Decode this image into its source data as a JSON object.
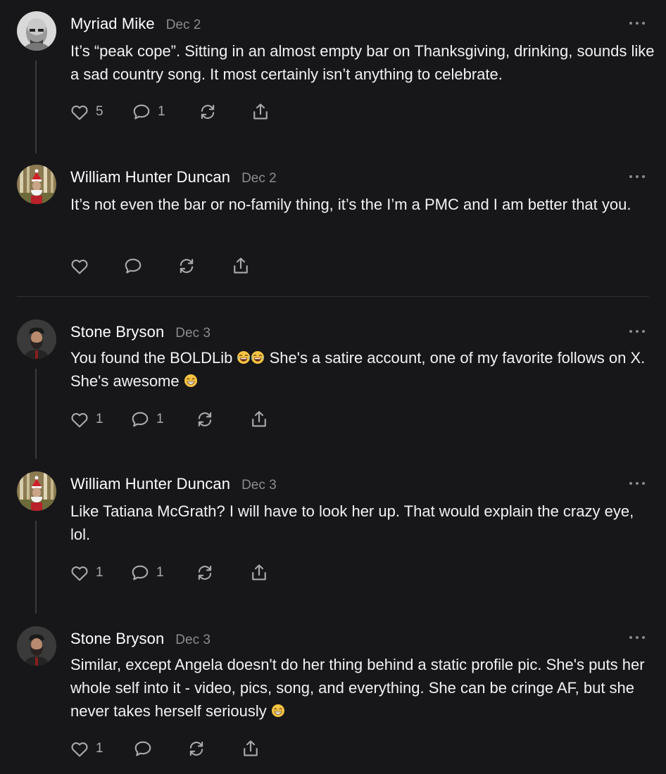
{
  "comments": [
    {
      "author": "Myriad Mike",
      "date": "Dec 2",
      "text": "It’s “peak cope”. Sitting in an almost empty bar on Thanksgiving, drinking, sounds like a sad country song. It most certainly isn’t anything to celebrate.",
      "likes": "5",
      "replies": "1",
      "avatar_icon": "bald-man-avatar"
    },
    {
      "author": "William Hunter Duncan",
      "date": "Dec 2",
      "text": "It’s not even the bar or no-family thing, it’s the I’m a PMC and I am better that you.",
      "likes": "",
      "replies": "",
      "avatar_icon": "santa-forest-avatar"
    },
    {
      "author": "Stone Bryson",
      "date": "Dec 3",
      "text_a": "You found the BOLDLib ",
      "text_b": " She's a satire account, one of my favorite follows on X. She's awesome ",
      "likes": "1",
      "replies": "1",
      "avatar_icon": "bearded-man-avatar"
    },
    {
      "author": "William Hunter Duncan",
      "date": "Dec 3",
      "text": "Like Tatiana McGrath? I will have to look her up. That would explain the crazy eye, lol.",
      "likes": "1",
      "replies": "1",
      "avatar_icon": "santa-forest-avatar"
    },
    {
      "author": "Stone Bryson",
      "date": "Dec 3",
      "text_a": "Similar, except Angela doesn't do her thing behind a static profile pic. She's puts her whole self into it - video, pics, song, and everything. She can be cringe AF, but she never takes herself seriously ",
      "likes": "1",
      "replies": "",
      "avatar_icon": "bearded-man-avatar"
    }
  ],
  "colors": {
    "background": "#17171a",
    "text": "#f2f2f4",
    "muted": "#8b8b90",
    "icon": "#a9a9ae"
  }
}
